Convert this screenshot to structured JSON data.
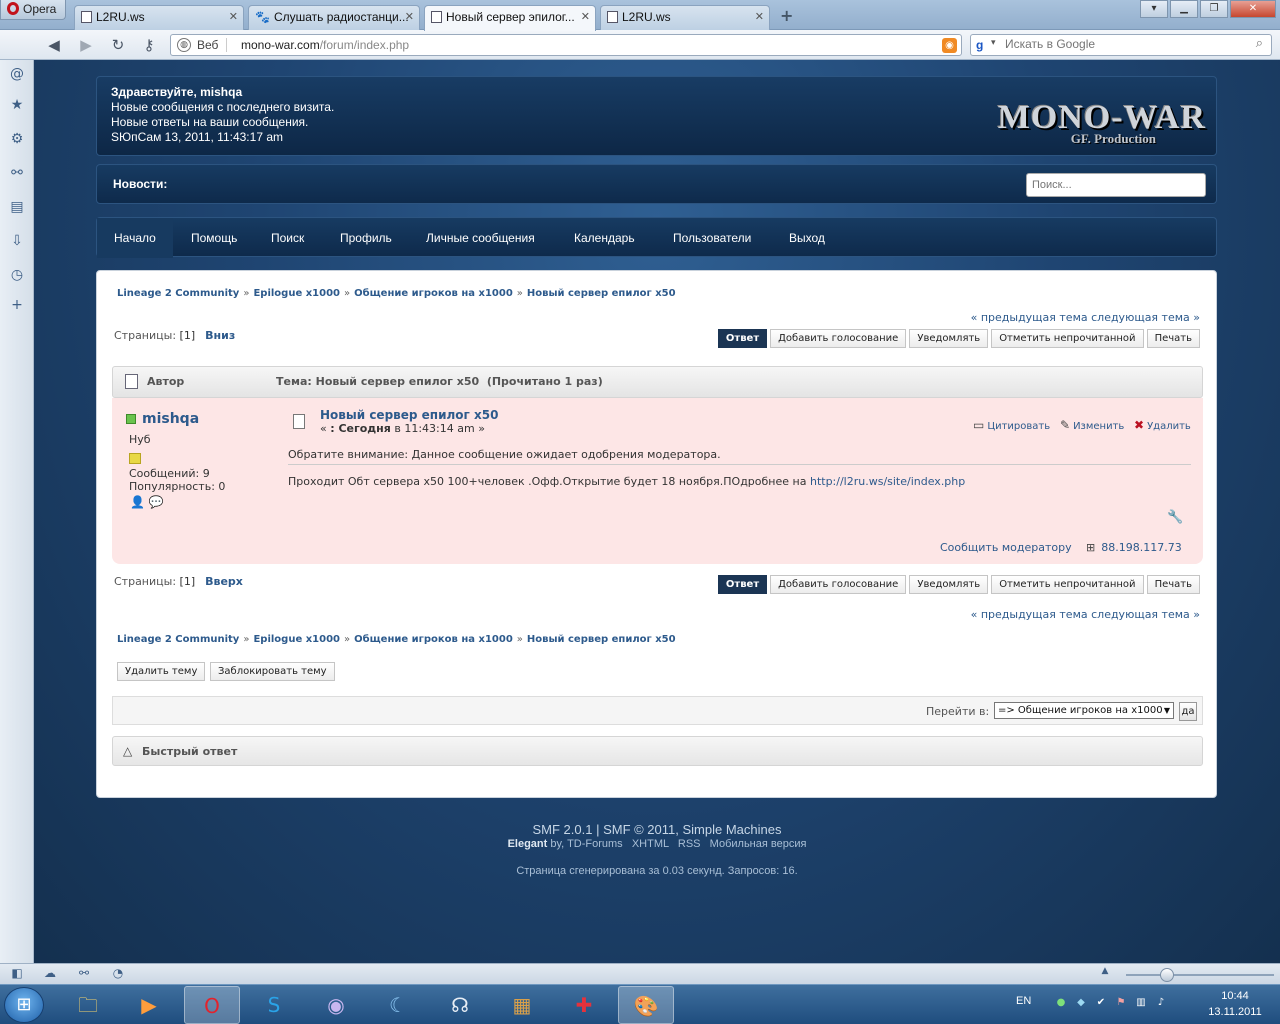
{
  "browser": {
    "menu_label": "Opera",
    "tabs": [
      {
        "title": "L2RU.ws"
      },
      {
        "title": "Слушать радиостанци..."
      },
      {
        "title": "Новый сервер эпилог..."
      },
      {
        "title": "L2RU.ws"
      }
    ],
    "address": {
      "mode": "Веб",
      "domain": "mono-war.com",
      "path": "/forum/index.php"
    },
    "search_placeholder": "Искать в Google"
  },
  "header": {
    "greeting": "Здравствуйте, mishqa",
    "new_posts": "Новые сообщения с последнего визита.",
    "new_replies": "Новые ответы на ваши сообщения.",
    "datetime": "SЮпСам 13, 2011, 11:43:17 am",
    "logo": "MONO-WAR",
    "logo_sub": "GF. Production"
  },
  "news": {
    "label": "Новости:",
    "search_placeholder": "Поиск..."
  },
  "menu": [
    "Начало",
    "Помощь",
    "Поиск",
    "Профиль",
    "Личные сообщения",
    "Календарь",
    "Пользователи",
    "Выход"
  ],
  "breadcrumb": [
    "Lineage 2 Community",
    "Epilogue x1000",
    "Общение игроков на x1000",
    "Новый сервер епилог x50"
  ],
  "breadcrumb_sep": "»",
  "prev_next": "« предыдущая тема следующая тема »",
  "pages": {
    "label": "Страницы:",
    "current": "[1]",
    "down": "Вниз",
    "up": "Вверх"
  },
  "buttons": {
    "reply": "Ответ",
    "poll": "Добавить голосование",
    "notify": "Уведомлять",
    "unread": "Отметить непрочитанной",
    "print": "Печать"
  },
  "topic_header": {
    "author": "Автор",
    "topic": "Тема: Новый сервер епилог x50  (Прочитано 1 раз)"
  },
  "post": {
    "username": "mishqa",
    "rank": "Нуб",
    "posts_stat": "Сообщений: 9",
    "karma_stat": "Популярность: 0",
    "title": "Новый сервер епилог x50",
    "date_prefix": "« ",
    "date_strong": ": Сегодня",
    "date_rest": " в 11:43:14 am »",
    "quote": "Цитировать",
    "edit": "Изменить",
    "delete": "Удалить",
    "warning": "Обратите внимание: Данное сообщение ожидает одобрения модератора.",
    "body": "Проходит Обт сервера x50 100+человек .Офф.Открытие будет 18 ноября.ПОдробнее на ",
    "body_link": "http://l2ru.ws/site/index.php",
    "report": "Сообщить модератору",
    "ip": "88.198.117.73"
  },
  "mod_buttons": {
    "remove": "Удалить тему",
    "lock": "Заблокировать тему"
  },
  "jump": {
    "label": "Перейти в:",
    "selected": "=> Общение игроков на x1000",
    "go": "да"
  },
  "quick_reply": "Быстрый ответ",
  "footer": {
    "line1": "SMF 2.0.1 | SMF © 2011, Simple Machines",
    "theme_name": "Elegant",
    "theme_rest": " by, TD-Forums   XHTML   RSS   Мобильная версия",
    "line3": "Страница сгенерирована за 0.03 секунд. Запросов: 16."
  },
  "taskbar": {
    "lang": "EN",
    "time": "10:44",
    "date": "13.11.2011"
  }
}
